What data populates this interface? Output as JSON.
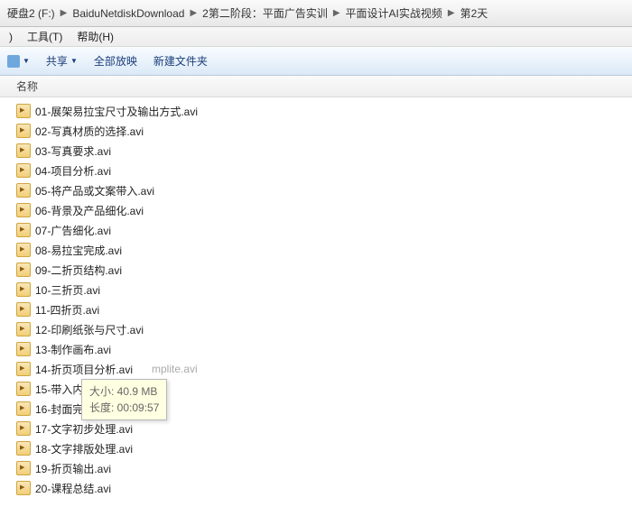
{
  "breadcrumbs": [
    "硬盘2 (F:)",
    "BaiduNetdiskDownload",
    "2第二阶段：平面广告实训",
    "平面设计AI实战视频",
    "第2天"
  ],
  "menu": {
    "close_paren": ")",
    "tools": "工具(T)",
    "help": "帮助(H)"
  },
  "toolbar": {
    "share": "共享",
    "play_all": "全部放映",
    "new_folder": "新建文件夹"
  },
  "column": {
    "name": "名称"
  },
  "files": [
    "01-展架易拉宝尺寸及输出方式.avi",
    "02-写真材质的选择.avi",
    "03-写真要求.avi",
    "04-项目分析.avi",
    "05-将产品或文案带入.avi",
    "06-背景及产品细化.avi",
    "07-广告细化.avi",
    "08-易拉宝完成.avi",
    "09-二折页结构.avi",
    "10-三折页.avi",
    "11-四折页.avi",
    "12-印刷纸张与尺寸.avi",
    "13-制作画布.avi",
    "14-折页项目分析.avi",
    "15-带入内容.avi",
    "16-封面完成.avi",
    "17-文字初步处理.avi",
    "18-文字排版处理.avi",
    "19-折页输出.avi",
    "20-课程总结.avi"
  ],
  "ghost_text": "mplite.avi",
  "tooltip": {
    "line1": "大小: 40.9 MB",
    "line2": "长度: 00:09:57"
  }
}
